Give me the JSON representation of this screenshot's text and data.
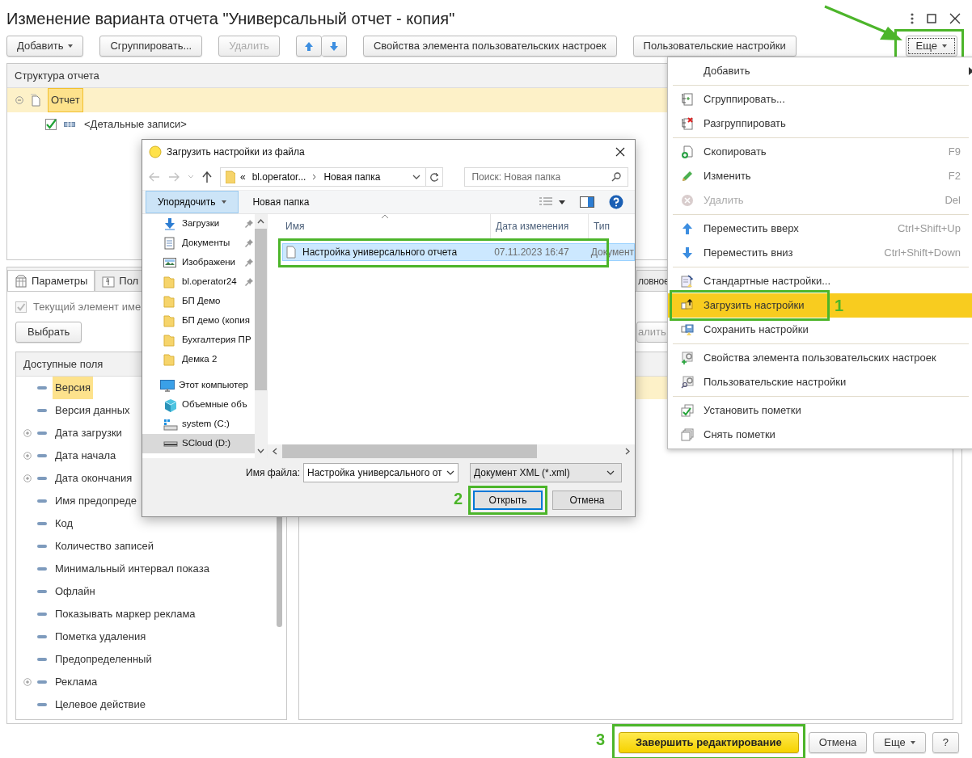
{
  "window": {
    "title": "Изменение варианта отчета \"Универсальный отчет - копия\""
  },
  "toolbar": [
    {
      "kind": "dropdown",
      "label": "Добавить",
      "disabled": false
    },
    {
      "kind": "button",
      "label": "Сгруппировать...",
      "disabled": false
    },
    {
      "kind": "button",
      "label": "Удалить",
      "disabled": true
    },
    {
      "kind": "arrows"
    },
    {
      "kind": "button",
      "label": "Свойства элемента пользовательских настроек",
      "disabled": false
    },
    {
      "kind": "button",
      "label": "Пользовательские настройки",
      "disabled": false
    }
  ],
  "more_button": {
    "label": "Еще",
    "highlighted": true
  },
  "structure": {
    "header": "Структура отчета",
    "items": [
      {
        "label": "Отчет",
        "selected": true,
        "expanded": true,
        "children": [
          {
            "label": "<Детальные записи>",
            "checked": true
          }
        ]
      }
    ]
  },
  "settings_tabs": [
    {
      "label": "Параметры",
      "kind": "parameters",
      "selected": true
    },
    {
      "label": "Пол",
      "kind": "fields",
      "selected": false
    },
    {
      "label": "ловное",
      "kind": "plain",
      "selected": false
    }
  ],
  "current_element": {
    "label": "Текущий элемент име",
    "checked": true,
    "disabled": true
  },
  "choose_button": "Выбрать",
  "remove_button_fragment": "алить",
  "available_fields": {
    "header": "Доступные поля",
    "items": [
      {
        "label": "Версия",
        "selected": true,
        "expandable": false
      },
      {
        "label": "Версия данных",
        "selected": false,
        "expandable": false
      },
      {
        "label": "Дата загрузки",
        "selected": false,
        "expandable": true
      },
      {
        "label": "Дата начала",
        "selected": false,
        "expandable": true
      },
      {
        "label": "Дата окончания",
        "selected": false,
        "expandable": true
      },
      {
        "label": "Имя предопреде",
        "selected": false,
        "expandable": false
      },
      {
        "label": "Код",
        "selected": false,
        "expandable": false
      },
      {
        "label": "Количество записей",
        "selected": false,
        "expandable": false
      },
      {
        "label": "Минимальный интервал показа",
        "selected": false,
        "expandable": false
      },
      {
        "label": "Офлайн",
        "selected": false,
        "expandable": false
      },
      {
        "label": "Показывать маркер реклама",
        "selected": false,
        "expandable": false
      },
      {
        "label": "Пометка удаления",
        "selected": false,
        "expandable": false
      },
      {
        "label": "Предопределенный",
        "selected": false,
        "expandable": false
      },
      {
        "label": "Реклама",
        "selected": false,
        "expandable": true
      },
      {
        "label": "Целевое действие",
        "selected": false,
        "expandable": false
      }
    ]
  },
  "footer_buttons": [
    {
      "kind": "primary",
      "label": "Завершить редактирование",
      "highlighted": true,
      "step": "3"
    },
    {
      "kind": "plain",
      "label": "Отмена"
    },
    {
      "kind": "dropdown",
      "label": "Еще"
    },
    {
      "kind": "plain",
      "label": "?"
    }
  ],
  "menu": {
    "groups": [
      [
        {
          "label": "Добавить",
          "kind": "submenu",
          "disabled": false,
          "selected": false
        }
      ],
      [
        {
          "label": "Сгруппировать...",
          "kind": "group",
          "disabled": false,
          "selected": false
        },
        {
          "label": "Разгруппировать",
          "kind": "ungroup",
          "disabled": false,
          "selected": false
        }
      ],
      [
        {
          "label": "Скопировать",
          "kind": "copy",
          "shortcut": "F9",
          "disabled": false,
          "selected": false
        },
        {
          "label": "Изменить",
          "kind": "edit",
          "shortcut": "F2",
          "disabled": false,
          "selected": false
        },
        {
          "label": "Удалить",
          "kind": "delete",
          "shortcut": "Del",
          "disabled": true,
          "selected": false
        }
      ],
      [
        {
          "label": "Переместить вверх",
          "kind": "up",
          "shortcut": "Ctrl+Shift+Up",
          "disabled": false,
          "selected": false
        },
        {
          "label": "Переместить вниз",
          "kind": "down",
          "shortcut": "Ctrl+Shift+Down",
          "disabled": false,
          "selected": false
        }
      ],
      [
        {
          "label": "Стандартные настройки...",
          "kind": "defaults",
          "disabled": false,
          "selected": false
        },
        {
          "label": "Загрузить настройки",
          "kind": "load",
          "disabled": false,
          "selected": true,
          "highlighted": true,
          "step": "1"
        },
        {
          "label": "Сохранить настройки",
          "kind": "save",
          "disabled": false,
          "selected": false
        }
      ],
      [
        {
          "label": "Свойства элемента пользовательских настроек",
          "kind": "element-props",
          "disabled": false,
          "selected": false
        },
        {
          "label": "Пользовательские настройки",
          "kind": "user-settings",
          "disabled": false,
          "selected": false
        }
      ],
      [
        {
          "label": "Установить пометки",
          "kind": "check-all",
          "disabled": false,
          "selected": false
        },
        {
          "label": "Снять пометки",
          "kind": "uncheck-all",
          "disabled": false,
          "selected": false
        }
      ]
    ]
  },
  "file_dialog": {
    "title": "Загрузить настройки из файла",
    "path": [
      "«",
      "bl.operator...",
      "Новая папка"
    ],
    "search": {
      "placeholder": "Поиск: Новая папка"
    },
    "organize": "Упорядочить",
    "new_folder": "Новая папка",
    "nav": [
      {
        "label": "Загрузки",
        "kind": "download",
        "pinned": true,
        "selected": false
      },
      {
        "label": "Документы",
        "kind": "documents",
        "pinned": true,
        "selected": false
      },
      {
        "label": "Изображени",
        "kind": "images",
        "pinned": true,
        "selected": false
      },
      {
        "label": "bl.operator24",
        "kind": "folder",
        "pinned": true,
        "selected": false
      },
      {
        "label": "БП Демо",
        "kind": "folder",
        "selected": false
      },
      {
        "label": "БП демо (копия",
        "kind": "folder",
        "selected": false
      },
      {
        "label": "Бухгалтерия ПР",
        "kind": "folder",
        "selected": false
      },
      {
        "label": "Демка 2",
        "kind": "folder",
        "selected": false
      },
      {
        "label": "Этот компьютер",
        "kind": "computer",
        "selected": false,
        "children": [
          {
            "label": "Объемные объ",
            "kind": "cube",
            "selected": false
          },
          {
            "label": "system (C:)",
            "kind": "system-drive",
            "selected": false
          },
          {
            "label": "SCloud (D:)",
            "kind": "drive",
            "selected": true
          }
        ]
      }
    ],
    "columns": [
      "Имя",
      "Дата изменения",
      "Тип"
    ],
    "files": [
      {
        "name": "Настройка универсального отчета",
        "date": "07.11.2023 16:47",
        "type": "Документ",
        "selected": true,
        "highlighted": true
      }
    ],
    "filename_label": "Имя файла:",
    "filename": "Настройка универсального от",
    "filter": "Документ XML (*.xml)",
    "buttons": [
      {
        "label": "Открыть",
        "kind": "default",
        "highlighted": true,
        "step": "2"
      },
      {
        "label": "Отмена",
        "kind": "plain"
      }
    ]
  }
}
